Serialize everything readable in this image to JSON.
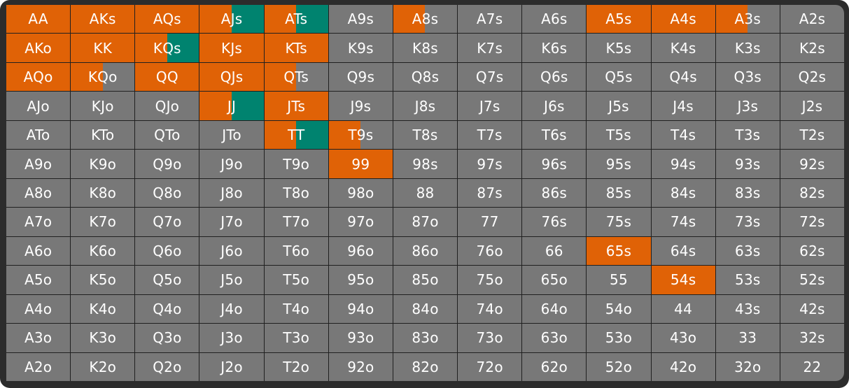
{
  "colors": {
    "background": "#2c2c2c",
    "cell": "#787878",
    "raise": "#e06206",
    "call": "#00836f",
    "text": "#ffffff"
  },
  "grid": {
    "rows": [
      [
        {
          "label": "AA",
          "raise": 1,
          "call": 0
        },
        {
          "label": "AKs",
          "raise": 1,
          "call": 0
        },
        {
          "label": "AQs",
          "raise": 1,
          "call": 0
        },
        {
          "label": "AJs",
          "raise": 0.5,
          "call": 0.5
        },
        {
          "label": "ATs",
          "raise": 0.5,
          "call": 0.5
        },
        {
          "label": "A9s",
          "raise": 0,
          "call": 0
        },
        {
          "label": "A8s",
          "raise": 0.5,
          "call": 0
        },
        {
          "label": "A7s",
          "raise": 0,
          "call": 0
        },
        {
          "label": "A6s",
          "raise": 0,
          "call": 0
        },
        {
          "label": "A5s",
          "raise": 1,
          "call": 0
        },
        {
          "label": "A4s",
          "raise": 1,
          "call": 0
        },
        {
          "label": "A3s",
          "raise": 0.5,
          "call": 0
        },
        {
          "label": "A2s",
          "raise": 0,
          "call": 0
        }
      ],
      [
        {
          "label": "AKo",
          "raise": 1,
          "call": 0
        },
        {
          "label": "KK",
          "raise": 1,
          "call": 0
        },
        {
          "label": "KQs",
          "raise": 0.5,
          "call": 0.5
        },
        {
          "label": "KJs",
          "raise": 1,
          "call": 0
        },
        {
          "label": "KTs",
          "raise": 1,
          "call": 0
        },
        {
          "label": "K9s",
          "raise": 0,
          "call": 0
        },
        {
          "label": "K8s",
          "raise": 0,
          "call": 0
        },
        {
          "label": "K7s",
          "raise": 0,
          "call": 0
        },
        {
          "label": "K6s",
          "raise": 0,
          "call": 0
        },
        {
          "label": "K5s",
          "raise": 0,
          "call": 0
        },
        {
          "label": "K4s",
          "raise": 0,
          "call": 0
        },
        {
          "label": "K3s",
          "raise": 0,
          "call": 0
        },
        {
          "label": "K2s",
          "raise": 0,
          "call": 0
        }
      ],
      [
        {
          "label": "AQo",
          "raise": 1,
          "call": 0
        },
        {
          "label": "KQo",
          "raise": 0.5,
          "call": 0
        },
        {
          "label": "QQ",
          "raise": 1,
          "call": 0
        },
        {
          "label": "QJs",
          "raise": 1,
          "call": 0
        },
        {
          "label": "QTs",
          "raise": 0.5,
          "call": 0
        },
        {
          "label": "Q9s",
          "raise": 0,
          "call": 0
        },
        {
          "label": "Q8s",
          "raise": 0,
          "call": 0
        },
        {
          "label": "Q7s",
          "raise": 0,
          "call": 0
        },
        {
          "label": "Q6s",
          "raise": 0,
          "call": 0
        },
        {
          "label": "Q5s",
          "raise": 0,
          "call": 0
        },
        {
          "label": "Q4s",
          "raise": 0,
          "call": 0
        },
        {
          "label": "Q3s",
          "raise": 0,
          "call": 0
        },
        {
          "label": "Q2s",
          "raise": 0,
          "call": 0
        }
      ],
      [
        {
          "label": "AJo",
          "raise": 0,
          "call": 0
        },
        {
          "label": "KJo",
          "raise": 0,
          "call": 0
        },
        {
          "label": "QJo",
          "raise": 0,
          "call": 0
        },
        {
          "label": "JJ",
          "raise": 0.5,
          "call": 0.5
        },
        {
          "label": "JTs",
          "raise": 1,
          "call": 0
        },
        {
          "label": "J9s",
          "raise": 0,
          "call": 0
        },
        {
          "label": "J8s",
          "raise": 0,
          "call": 0
        },
        {
          "label": "J7s",
          "raise": 0,
          "call": 0
        },
        {
          "label": "J6s",
          "raise": 0,
          "call": 0
        },
        {
          "label": "J5s",
          "raise": 0,
          "call": 0
        },
        {
          "label": "J4s",
          "raise": 0,
          "call": 0
        },
        {
          "label": "J3s",
          "raise": 0,
          "call": 0
        },
        {
          "label": "J2s",
          "raise": 0,
          "call": 0
        }
      ],
      [
        {
          "label": "ATo",
          "raise": 0,
          "call": 0
        },
        {
          "label": "KTo",
          "raise": 0,
          "call": 0
        },
        {
          "label": "QTo",
          "raise": 0,
          "call": 0
        },
        {
          "label": "JTo",
          "raise": 0,
          "call": 0
        },
        {
          "label": "TT",
          "raise": 0.5,
          "call": 0.5
        },
        {
          "label": "T9s",
          "raise": 0.5,
          "call": 0
        },
        {
          "label": "T8s",
          "raise": 0,
          "call": 0
        },
        {
          "label": "T7s",
          "raise": 0,
          "call": 0
        },
        {
          "label": "T6s",
          "raise": 0,
          "call": 0
        },
        {
          "label": "T5s",
          "raise": 0,
          "call": 0
        },
        {
          "label": "T4s",
          "raise": 0,
          "call": 0
        },
        {
          "label": "T3s",
          "raise": 0,
          "call": 0
        },
        {
          "label": "T2s",
          "raise": 0,
          "call": 0
        }
      ],
      [
        {
          "label": "A9o",
          "raise": 0,
          "call": 0
        },
        {
          "label": "K9o",
          "raise": 0,
          "call": 0
        },
        {
          "label": "Q9o",
          "raise": 0,
          "call": 0
        },
        {
          "label": "J9o",
          "raise": 0,
          "call": 0
        },
        {
          "label": "T9o",
          "raise": 0,
          "call": 0
        },
        {
          "label": "99",
          "raise": 1,
          "call": 0
        },
        {
          "label": "98s",
          "raise": 0,
          "call": 0
        },
        {
          "label": "97s",
          "raise": 0,
          "call": 0
        },
        {
          "label": "96s",
          "raise": 0,
          "call": 0
        },
        {
          "label": "95s",
          "raise": 0,
          "call": 0
        },
        {
          "label": "94s",
          "raise": 0,
          "call": 0
        },
        {
          "label": "93s",
          "raise": 0,
          "call": 0
        },
        {
          "label": "92s",
          "raise": 0,
          "call": 0
        }
      ],
      [
        {
          "label": "A8o",
          "raise": 0,
          "call": 0
        },
        {
          "label": "K8o",
          "raise": 0,
          "call": 0
        },
        {
          "label": "Q8o",
          "raise": 0,
          "call": 0
        },
        {
          "label": "J8o",
          "raise": 0,
          "call": 0
        },
        {
          "label": "T8o",
          "raise": 0,
          "call": 0
        },
        {
          "label": "98o",
          "raise": 0,
          "call": 0
        },
        {
          "label": "88",
          "raise": 0,
          "call": 0
        },
        {
          "label": "87s",
          "raise": 0,
          "call": 0
        },
        {
          "label": "86s",
          "raise": 0,
          "call": 0
        },
        {
          "label": "85s",
          "raise": 0,
          "call": 0
        },
        {
          "label": "84s",
          "raise": 0,
          "call": 0
        },
        {
          "label": "83s",
          "raise": 0,
          "call": 0
        },
        {
          "label": "82s",
          "raise": 0,
          "call": 0
        }
      ],
      [
        {
          "label": "A7o",
          "raise": 0,
          "call": 0
        },
        {
          "label": "K7o",
          "raise": 0,
          "call": 0
        },
        {
          "label": "Q7o",
          "raise": 0,
          "call": 0
        },
        {
          "label": "J7o",
          "raise": 0,
          "call": 0
        },
        {
          "label": "T7o",
          "raise": 0,
          "call": 0
        },
        {
          "label": "97o",
          "raise": 0,
          "call": 0
        },
        {
          "label": "87o",
          "raise": 0,
          "call": 0
        },
        {
          "label": "77",
          "raise": 0,
          "call": 0
        },
        {
          "label": "76s",
          "raise": 0,
          "call": 0
        },
        {
          "label": "75s",
          "raise": 0,
          "call": 0
        },
        {
          "label": "74s",
          "raise": 0,
          "call": 0
        },
        {
          "label": "73s",
          "raise": 0,
          "call": 0
        },
        {
          "label": "72s",
          "raise": 0,
          "call": 0
        }
      ],
      [
        {
          "label": "A6o",
          "raise": 0,
          "call": 0
        },
        {
          "label": "K6o",
          "raise": 0,
          "call": 0
        },
        {
          "label": "Q6o",
          "raise": 0,
          "call": 0
        },
        {
          "label": "J6o",
          "raise": 0,
          "call": 0
        },
        {
          "label": "T6o",
          "raise": 0,
          "call": 0
        },
        {
          "label": "96o",
          "raise": 0,
          "call": 0
        },
        {
          "label": "86o",
          "raise": 0,
          "call": 0
        },
        {
          "label": "76o",
          "raise": 0,
          "call": 0
        },
        {
          "label": "66",
          "raise": 0,
          "call": 0
        },
        {
          "label": "65s",
          "raise": 1,
          "call": 0
        },
        {
          "label": "64s",
          "raise": 0,
          "call": 0
        },
        {
          "label": "63s",
          "raise": 0,
          "call": 0
        },
        {
          "label": "62s",
          "raise": 0,
          "call": 0
        }
      ],
      [
        {
          "label": "A5o",
          "raise": 0,
          "call": 0
        },
        {
          "label": "K5o",
          "raise": 0,
          "call": 0
        },
        {
          "label": "Q5o",
          "raise": 0,
          "call": 0
        },
        {
          "label": "J5o",
          "raise": 0,
          "call": 0
        },
        {
          "label": "T5o",
          "raise": 0,
          "call": 0
        },
        {
          "label": "95o",
          "raise": 0,
          "call": 0
        },
        {
          "label": "85o",
          "raise": 0,
          "call": 0
        },
        {
          "label": "75o",
          "raise": 0,
          "call": 0
        },
        {
          "label": "65o",
          "raise": 0,
          "call": 0
        },
        {
          "label": "55",
          "raise": 0,
          "call": 0
        },
        {
          "label": "54s",
          "raise": 1,
          "call": 0
        },
        {
          "label": "53s",
          "raise": 0,
          "call": 0
        },
        {
          "label": "52s",
          "raise": 0,
          "call": 0
        }
      ],
      [
        {
          "label": "A4o",
          "raise": 0,
          "call": 0
        },
        {
          "label": "K4o",
          "raise": 0,
          "call": 0
        },
        {
          "label": "Q4o",
          "raise": 0,
          "call": 0
        },
        {
          "label": "J4o",
          "raise": 0,
          "call": 0
        },
        {
          "label": "T4o",
          "raise": 0,
          "call": 0
        },
        {
          "label": "94o",
          "raise": 0,
          "call": 0
        },
        {
          "label": "84o",
          "raise": 0,
          "call": 0
        },
        {
          "label": "74o",
          "raise": 0,
          "call": 0
        },
        {
          "label": "64o",
          "raise": 0,
          "call": 0
        },
        {
          "label": "54o",
          "raise": 0,
          "call": 0
        },
        {
          "label": "44",
          "raise": 0,
          "call": 0
        },
        {
          "label": "43s",
          "raise": 0,
          "call": 0
        },
        {
          "label": "42s",
          "raise": 0,
          "call": 0
        }
      ],
      [
        {
          "label": "A3o",
          "raise": 0,
          "call": 0
        },
        {
          "label": "K3o",
          "raise": 0,
          "call": 0
        },
        {
          "label": "Q3o",
          "raise": 0,
          "call": 0
        },
        {
          "label": "J3o",
          "raise": 0,
          "call": 0
        },
        {
          "label": "T3o",
          "raise": 0,
          "call": 0
        },
        {
          "label": "93o",
          "raise": 0,
          "call": 0
        },
        {
          "label": "83o",
          "raise": 0,
          "call": 0
        },
        {
          "label": "73o",
          "raise": 0,
          "call": 0
        },
        {
          "label": "63o",
          "raise": 0,
          "call": 0
        },
        {
          "label": "53o",
          "raise": 0,
          "call": 0
        },
        {
          "label": "43o",
          "raise": 0,
          "call": 0
        },
        {
          "label": "33",
          "raise": 0,
          "call": 0
        },
        {
          "label": "32s",
          "raise": 0,
          "call": 0
        }
      ],
      [
        {
          "label": "A2o",
          "raise": 0,
          "call": 0
        },
        {
          "label": "K2o",
          "raise": 0,
          "call": 0
        },
        {
          "label": "Q2o",
          "raise": 0,
          "call": 0
        },
        {
          "label": "J2o",
          "raise": 0,
          "call": 0
        },
        {
          "label": "T2o",
          "raise": 0,
          "call": 0
        },
        {
          "label": "92o",
          "raise": 0,
          "call": 0
        },
        {
          "label": "82o",
          "raise": 0,
          "call": 0
        },
        {
          "label": "72o",
          "raise": 0,
          "call": 0
        },
        {
          "label": "62o",
          "raise": 0,
          "call": 0
        },
        {
          "label": "52o",
          "raise": 0,
          "call": 0
        },
        {
          "label": "42o",
          "raise": 0,
          "call": 0
        },
        {
          "label": "32o",
          "raise": 0,
          "call": 0
        },
        {
          "label": "22",
          "raise": 0,
          "call": 0
        }
      ]
    ]
  }
}
